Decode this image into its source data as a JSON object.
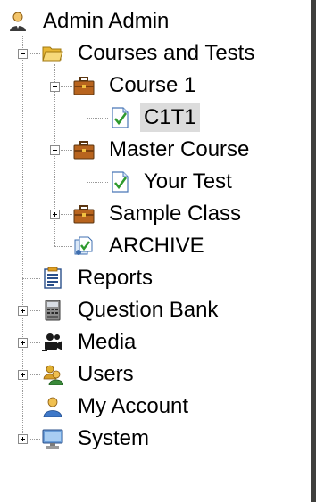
{
  "tree": {
    "root": {
      "label": "Admin Admin",
      "icon": "admin-user-icon"
    },
    "items": [
      {
        "label": "Courses and Tests",
        "icon": "folder-open-icon",
        "expanded": true
      },
      {
        "label": "Course 1",
        "icon": "briefcase-icon",
        "expanded": true
      },
      {
        "label": "C1T1",
        "icon": "test-check-icon",
        "selected": true
      },
      {
        "label": "Master Course",
        "icon": "briefcase-icon",
        "expanded": true
      },
      {
        "label": "Your Test",
        "icon": "test-check-icon"
      },
      {
        "label": "Sample Class",
        "icon": "briefcase-icon",
        "expanded": false
      },
      {
        "label": "ARCHIVE",
        "icon": "archive-icon"
      },
      {
        "label": "Reports",
        "icon": "reports-icon"
      },
      {
        "label": "Question Bank",
        "icon": "question-bank-icon",
        "expanded": false
      },
      {
        "label": "Media",
        "icon": "camera-icon",
        "expanded": false
      },
      {
        "label": "Users",
        "icon": "users-icon",
        "expanded": false
      },
      {
        "label": "My Account",
        "icon": "my-account-icon"
      },
      {
        "label": "System",
        "icon": "monitor-icon",
        "expanded": false
      }
    ]
  },
  "colors": {
    "selection_background": "#dcdcdc",
    "panel_border": "#3f3f3d"
  }
}
